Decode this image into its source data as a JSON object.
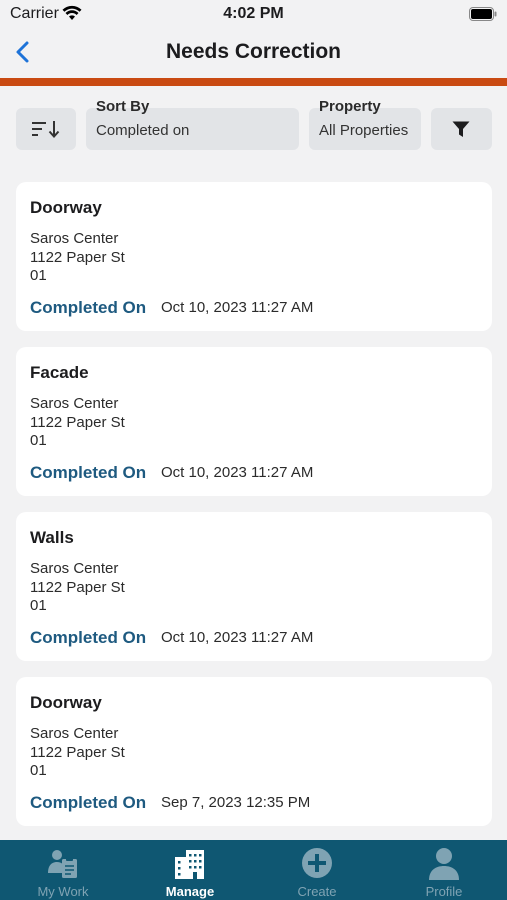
{
  "status_bar": {
    "carrier": "Carrier",
    "time": "4:02 PM"
  },
  "nav": {
    "title": "Needs Correction"
  },
  "colors": {
    "accent": "#c94a12",
    "tab_bar": "#0f5772",
    "link_blue": "#1e5a80"
  },
  "filters": {
    "sort_by_label": "Sort By",
    "sort_by_value": "Completed on",
    "property_label": "Property",
    "property_value": "All Properties"
  },
  "items": [
    {
      "title": "Doorway",
      "property": "Saros Center",
      "address": "1122 Paper St",
      "unit": "01",
      "completed_label": "Completed On",
      "completed_value": "Oct 10, 2023 11:27 AM"
    },
    {
      "title": "Facade",
      "property": "Saros Center",
      "address": "1122 Paper St",
      "unit": "01",
      "completed_label": "Completed On",
      "completed_value": "Oct 10, 2023 11:27 AM"
    },
    {
      "title": "Walls",
      "property": "Saros Center",
      "address": "1122 Paper St",
      "unit": "01",
      "completed_label": "Completed On",
      "completed_value": "Oct 10, 2023 11:27 AM"
    },
    {
      "title": "Doorway",
      "property": "Saros Center",
      "address": "1122 Paper St",
      "unit": "01",
      "completed_label": "Completed On",
      "completed_value": "Sep 7, 2023 12:35 PM"
    }
  ],
  "tabs": [
    {
      "label": "My Work",
      "icon": "my-work-icon",
      "active": false
    },
    {
      "label": "Manage",
      "icon": "building-icon",
      "active": true
    },
    {
      "label": "Create",
      "icon": "plus-circle-icon",
      "active": false
    },
    {
      "label": "Profile",
      "icon": "person-icon",
      "active": false
    }
  ]
}
